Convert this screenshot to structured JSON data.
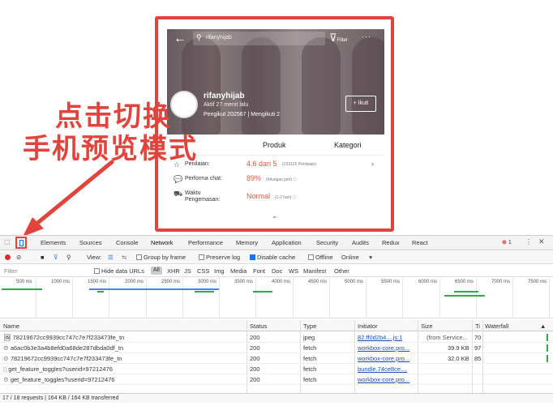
{
  "mobile": {
    "search_text": "rifanyhijab",
    "filter_label": "Filter",
    "more_icon": "···",
    "shop_name": "rifanyhijab",
    "active_text": "Aktif 27 menit lalu",
    "follow_stats": "Pengikut 202567 | Mengikuti 2",
    "follow_button": "+ Ikuti",
    "tabs": [
      "Produk",
      "Kategori"
    ],
    "info": [
      {
        "icon": "star-icon",
        "label": "Penilaian:",
        "value": "4.6 dari 5",
        "sub": "(233125 Penilaian)"
      },
      {
        "icon": "chat-icon",
        "label": "Performa chat:",
        "value": "89%",
        "sub": "(hitungan jam) ⓘ"
      },
      {
        "icon": "truck-icon",
        "label": "Waktu Pengemasan:",
        "value": "Normal",
        "sub": "(1-2 hari) ⓘ"
      }
    ],
    "accent_color": "#e5543b"
  },
  "annotation": {
    "line1": "点击切换",
    "line2": "手机预览模式",
    "color": "#e0443c"
  },
  "devtools": {
    "tabs": [
      "Elements",
      "Sources",
      "Console",
      "Network",
      "Performance",
      "Memory",
      "Application",
      "Security",
      "Audits",
      "Redux",
      "React"
    ],
    "error_count": "1",
    "toolbar": {
      "view_label": "View:",
      "group_by_frame": "Group by frame",
      "preserve_log": "Preserve log",
      "disable_cache": "Disable cache",
      "offline": "Offline",
      "throttle": "Online"
    },
    "filter": {
      "placeholder": "Filter",
      "hide_data_urls": "Hide data URLs",
      "types": [
        "All",
        "XHR",
        "JS",
        "CSS",
        "Img",
        "Media",
        "Font",
        "Doc",
        "WS",
        "Manifest",
        "Other"
      ]
    },
    "timeline_ticks": [
      "500 ms",
      "1000 ms",
      "1500 ms",
      "2000 ms",
      "2500 ms",
      "3000 ms",
      "3500 ms",
      "4000 ms",
      "4500 ms",
      "5000 ms",
      "5500 ms",
      "6000 ms",
      "6500 ms",
      "7000 ms",
      "7500 ms"
    ],
    "columns": [
      "Name",
      "Status",
      "Type",
      "Initiator",
      "Size",
      "Ti",
      "Waterfall"
    ],
    "rows": [
      {
        "name": "78219672cc9939cc747c7e7f233473fe_tn",
        "status": "200",
        "type": "jpeg",
        "initiator": "82.ff0d2b4....js:1",
        "size": "(from Service...",
        "time": "70"
      },
      {
        "name": "a6ac0b3e3a4b8efd0a68de287dbda0df_tn",
        "status": "200",
        "type": "fetch",
        "initiator": "workbox-core.pro...",
        "size": "39.9 KB",
        "time": "97"
      },
      {
        "name": "78219672cc9939cc747c7e7f233473fe_tn",
        "status": "200",
        "type": "fetch",
        "initiator": "workbox-core.pro...",
        "size": "32.0 KB",
        "time": "85"
      },
      {
        "name": "get_feature_toggles?userid=97212476",
        "status": "200",
        "type": "fetch",
        "initiator": "bundle.74ce8ce....",
        "size": "",
        "time": ""
      },
      {
        "name": "get_feature_toggles?userid=97212476",
        "status": "200",
        "type": "fetch",
        "initiator": "workbox-core.pro...",
        "size": "",
        "time": ""
      }
    ],
    "status_bar": "17 / 18 requests | 164 KB / 164 KB transferred"
  }
}
